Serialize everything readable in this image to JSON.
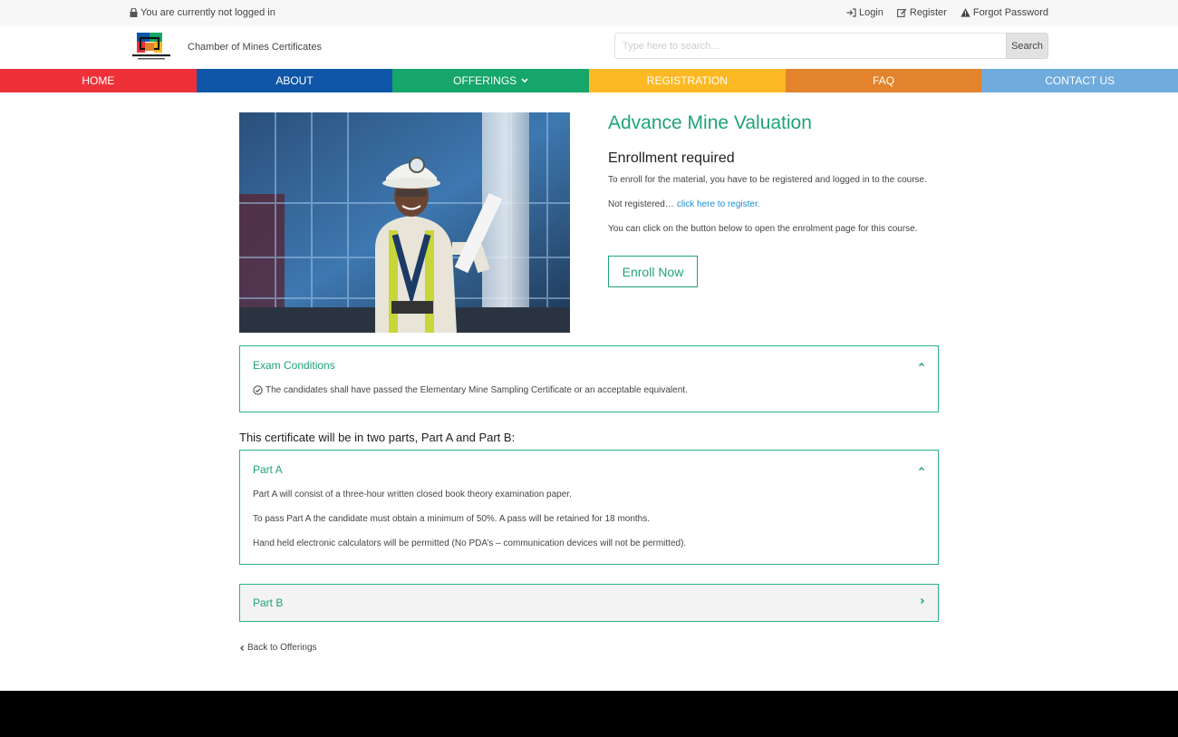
{
  "topbar": {
    "status": "You are currently not logged in",
    "links": [
      {
        "label": "Login",
        "icon": "sign-in-icon"
      },
      {
        "label": "Register",
        "icon": "edit-icon"
      },
      {
        "label": "Forgot Password",
        "icon": "warning-icon"
      }
    ]
  },
  "header": {
    "site_name": "Chamber of Mines Certificates",
    "search": {
      "placeholder": "Type here to search...",
      "button_label": "Search"
    }
  },
  "nav": {
    "items": [
      {
        "label": "HOME",
        "color": "#ee3139"
      },
      {
        "label": "ABOUT",
        "color": "#0f56a8"
      },
      {
        "label": "OFFERINGS",
        "color": "#16a56a",
        "has_dropdown": true
      },
      {
        "label": "REGISTRATION",
        "color": "#fdb924"
      },
      {
        "label": "FAQ",
        "color": "#e3832b"
      },
      {
        "label": "CONTACT US",
        "color": "#6fabdc"
      }
    ]
  },
  "course": {
    "title": "Advance Mine Valuation",
    "enroll_heading": "Enrollment required",
    "enroll_text": "To enroll for the material, you have to be registered and logged in to the course.",
    "not_registered": "Not registered…",
    "register_link": "click here to register.",
    "enroll_page_text": "You can click on the button below to open the enrolment page for this course.",
    "enroll_button": "Enroll Now"
  },
  "exam_conditions": {
    "title": "Exam Conditions",
    "text": "The candidates shall have passed the Elementary Mine Sampling Certificate or an acceptable equivalent."
  },
  "parts_intro": "This certificate will be in two parts, Part A and Part B:",
  "part_a": {
    "title": "Part A",
    "lines": [
      "Part A will consist of a three-hour written closed book theory examination paper.",
      "To pass Part A the candidate must obtain a minimum of 50%.  A pass will be retained for 18 months.",
      "Hand held electronic calculators will be permitted (No PDA’s – communication devices will not be permitted)."
    ]
  },
  "part_b": {
    "title": "Part B"
  },
  "back_link": "Back to Offerings",
  "colors": {
    "accent": "#1fa37a",
    "link": "#1a8fd1"
  }
}
